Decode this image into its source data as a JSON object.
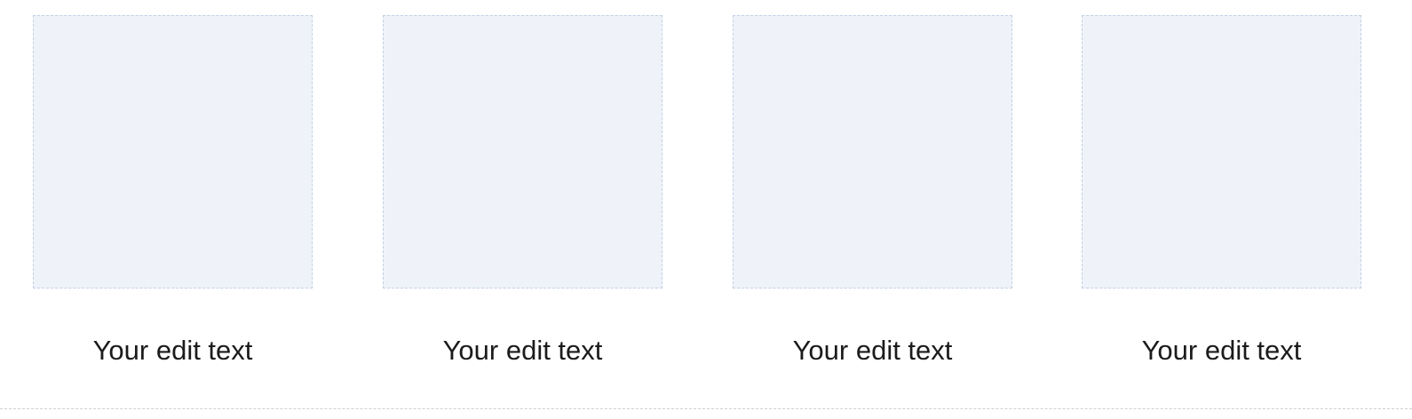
{
  "gallery": {
    "items": [
      {
        "caption": "Your edit text"
      },
      {
        "caption": "Your edit text"
      },
      {
        "caption": "Your edit text"
      },
      {
        "caption": "Your edit text"
      }
    ]
  },
  "colors": {
    "placeholder_fill": "#eff3f9",
    "placeholder_border": "#c3d1e6",
    "caption_text": "#1b1b1b",
    "divider": "#cfcfcf"
  }
}
